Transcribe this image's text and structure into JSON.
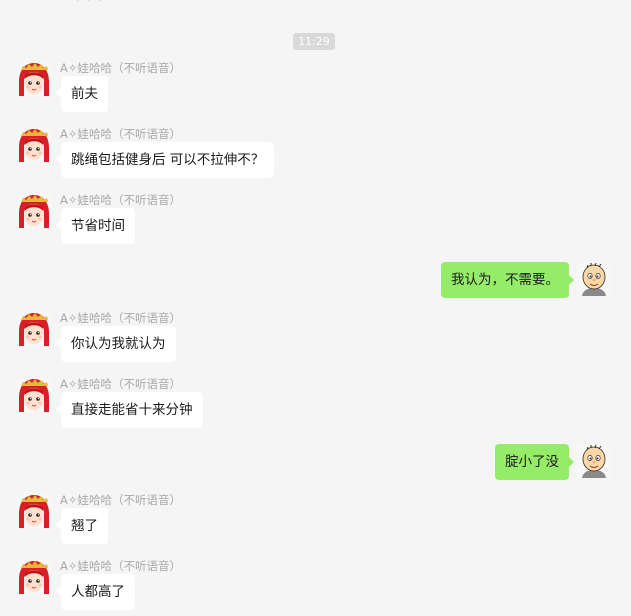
{
  "chat": {
    "time_divider": "11:29",
    "top_partial_text": "· · ·",
    "messages": [
      {
        "side": "left",
        "sender": "A✧娃哈哈（不听语音）",
        "text": "前夫"
      },
      {
        "side": "left",
        "sender": "A✧娃哈哈（不听语音）",
        "text": "跳绳包括健身后 可以不拉伸不？"
      },
      {
        "side": "left",
        "sender": "A✧娃哈哈（不听语音）",
        "text": "节省时间"
      },
      {
        "side": "right",
        "text": "我认为，不需要。"
      },
      {
        "side": "left",
        "sender": "A✧娃哈哈（不听语音）",
        "text": "你认为我就认为"
      },
      {
        "side": "left",
        "sender": "A✧娃哈哈（不听语音）",
        "text": "直接走能省十来分钟"
      },
      {
        "side": "right",
        "text": "腚小了没"
      },
      {
        "side": "left",
        "sender": "A✧娃哈哈（不听语音）",
        "text": "翘了"
      },
      {
        "side": "left",
        "sender": "A✧娃哈哈（不听语音）",
        "text": "人都高了"
      }
    ]
  },
  "icons": {
    "left_avatar": "cartoon-girl-avatar-icon",
    "right_avatar": "cartoon-boy-avatar-icon"
  },
  "colors": {
    "background": "#f5f5f5",
    "incoming_bubble": "#ffffff",
    "outgoing_bubble": "#95ec69",
    "sender_text": "#a8a8a8",
    "timestamp_bg": "#d9d9d9"
  }
}
